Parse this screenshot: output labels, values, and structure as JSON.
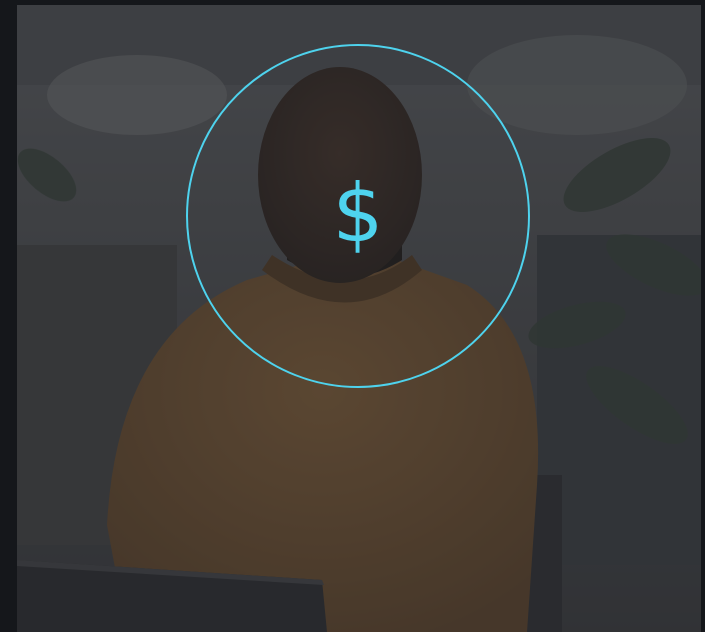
{
  "hero": {
    "icon": "dollar-icon",
    "symbol": "$",
    "accent_color": "#4ed3ee"
  }
}
